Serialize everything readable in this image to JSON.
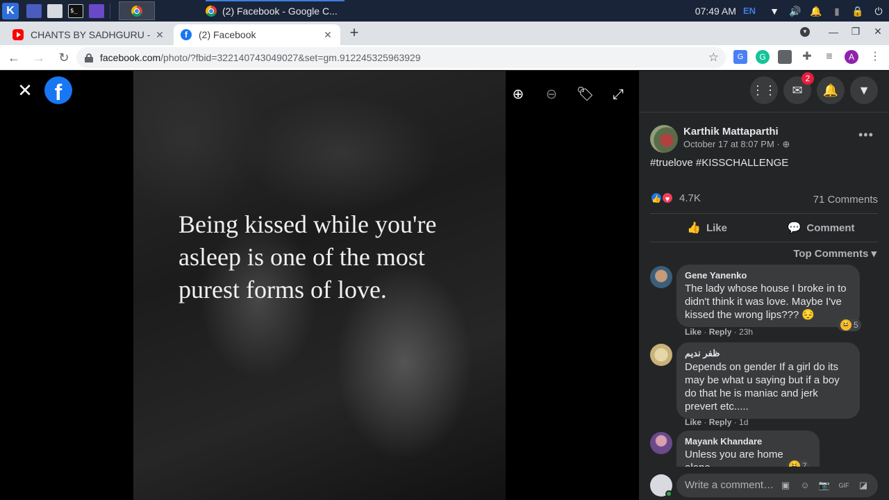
{
  "taskbar": {
    "window_title": "(2) Facebook - Google C...",
    "time": "07:49 AM",
    "lang": "EN"
  },
  "tabs": [
    {
      "title": "CHANTS BY SADHGURU -",
      "close": "✕"
    },
    {
      "title": "(2) Facebook",
      "close": "✕"
    }
  ],
  "address": {
    "host": "facebook.com",
    "path": "/photo/?fbid=322140743049027&set=gm.912245325963929"
  },
  "photo": {
    "quote_line1": "Being kissed while you're",
    "quote_line2": "asleep is one of the most",
    "quote_line3": "purest forms of love."
  },
  "panel": {
    "messenger_badge": "2",
    "post": {
      "author": "Karthik Mattaparthi",
      "time": "October 17 at 8:07 PM",
      "privacy_icon": "globe-icon",
      "text": "#truelove #KISSCHALLENGE",
      "reactions": "4.7K",
      "comments": "71 Comments"
    },
    "actions": {
      "like": "Like",
      "comment": "Comment"
    },
    "top_comments": "Top Comments",
    "comments": [
      {
        "name": "Gene Yanenko",
        "text": "The lady whose house I broke in to didn't think it was love. Maybe I've kissed the wrong lips??? 😔",
        "like": "Like",
        "reply": "Reply",
        "time": "23h",
        "reaction_count": "5"
      },
      {
        "name": "ظفر نديم",
        "text": "Depends on gender If a girl do its may be what u saying but if a boy do that he is maniac and jerk prevert etc.....",
        "like": "Like",
        "reply": "Reply",
        "time": "1d"
      },
      {
        "name": "Mayank Khandare",
        "text": "Unless you are home alone",
        "reaction_count": "7"
      }
    ],
    "write_placeholder": "Write a comment…"
  },
  "colors": {
    "fb_blue": "#1877f2",
    "panel_bg": "#242526",
    "bubble_bg": "#3a3b3c"
  }
}
